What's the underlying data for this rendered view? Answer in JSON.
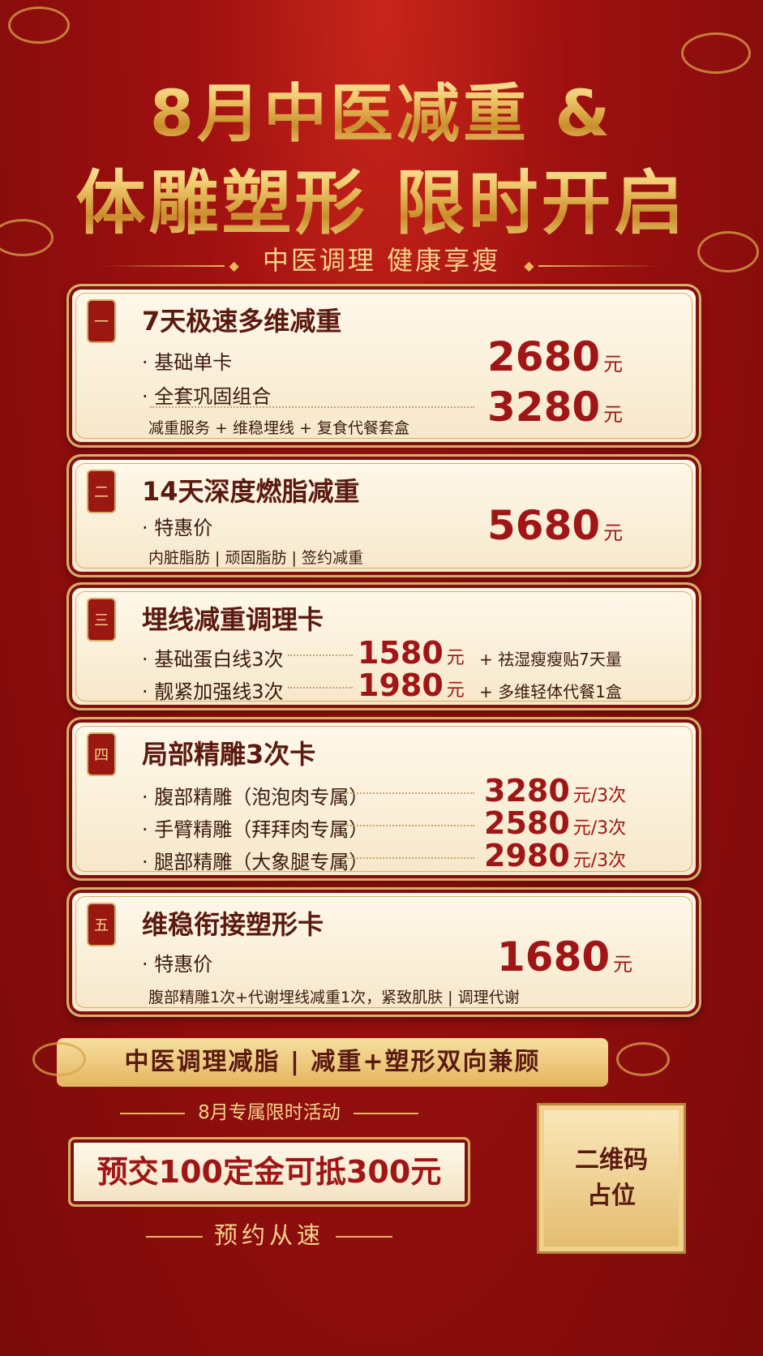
{
  "header": {
    "title_line1": "8月中医减重 &",
    "title_line2": "体雕塑形 限时开启",
    "subtitle": "中医调理   健康享瘦"
  },
  "cards": [
    {
      "badge": "一",
      "title": "7天极速多维减重",
      "items": [
        {
          "label": "· 基础单卡",
          "price": "2680",
          "unit": "元"
        },
        {
          "label": "· 全套巩固组合",
          "price": "3280",
          "unit": "元"
        }
      ],
      "desc": "减重服务 + 维稳埋线 + 复食代餐套盒"
    },
    {
      "badge": "二",
      "title": "14天深度燃脂减重",
      "items": [
        {
          "label": "· 特惠价",
          "price": "5680",
          "unit": "元"
        }
      ],
      "desc": "内脏脂肪 | 顽固脂肪 | 签约减重"
    },
    {
      "badge": "三",
      "title": "埋线减重调理卡",
      "items": [
        {
          "label": "· 基础蛋白线3次",
          "price": "1580",
          "unit": "元",
          "extra": "+ 祛湿瘦瘦贴7天量"
        },
        {
          "label": "· 靓紧加强线3次",
          "price": "1980",
          "unit": "元",
          "extra": "+ 多维轻体代餐1盒"
        }
      ]
    },
    {
      "badge": "四",
      "title": "局部精雕3次卡",
      "items": [
        {
          "label": "· 腹部精雕（泡泡肉专属）",
          "price": "3280",
          "unit": "元/3次"
        },
        {
          "label": "· 手臂精雕（拜拜肉专属）",
          "price": "2580",
          "unit": "元/3次"
        },
        {
          "label": "· 腿部精雕（大象腿专属）",
          "price": "2980",
          "unit": "元/3次"
        }
      ]
    },
    {
      "badge": "五",
      "title": "维稳衔接塑形卡",
      "items": [
        {
          "label": "· 特惠价",
          "price": "1680",
          "unit": "元"
        }
      ],
      "desc": "腹部精雕1次+代谢埋线减重1次，紧致肌肤 | 调理代谢"
    }
  ],
  "footer": {
    "banner": "中医调理减脂 | 减重+塑形双向兼顾",
    "august": "8月专属限时活动",
    "deposit": "预交100定金可抵300元",
    "book": "预约从速",
    "qr_line1": "二维码",
    "qr_line2": "占位"
  },
  "colors": {
    "background": "#9e1010",
    "gold": "#e8b85a",
    "price": "#a01616",
    "card": "#fff9ec"
  }
}
